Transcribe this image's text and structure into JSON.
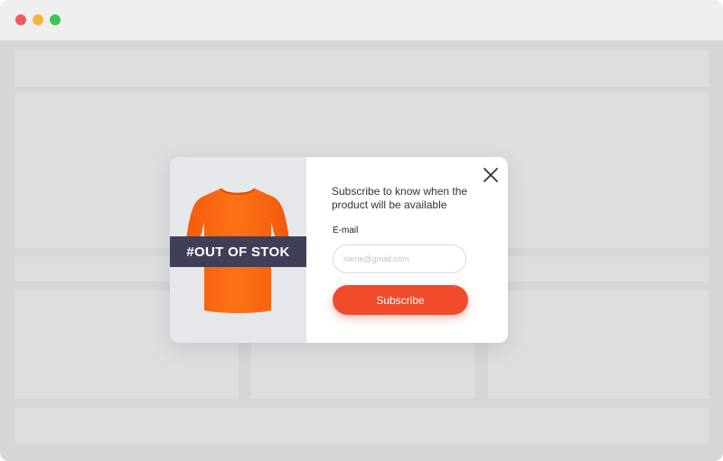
{
  "window": {
    "controls": [
      "close",
      "minimize",
      "maximize"
    ]
  },
  "popup": {
    "ribbon_text": "#OUT OF STOK",
    "product_image": "orange-tshirt",
    "headline": "Subscribe to know when the product will be available",
    "email_label": "E-mail",
    "email_placeholder": "name@gmail.com",
    "email_value": "",
    "subscribe_label": "Subscribe",
    "close_icon": "close-x-icon"
  },
  "colors": {
    "accent": "#f04c2c",
    "ribbon": "#3f3f58",
    "tshirt": "#ff6a13",
    "background": "#d6d6d6"
  }
}
